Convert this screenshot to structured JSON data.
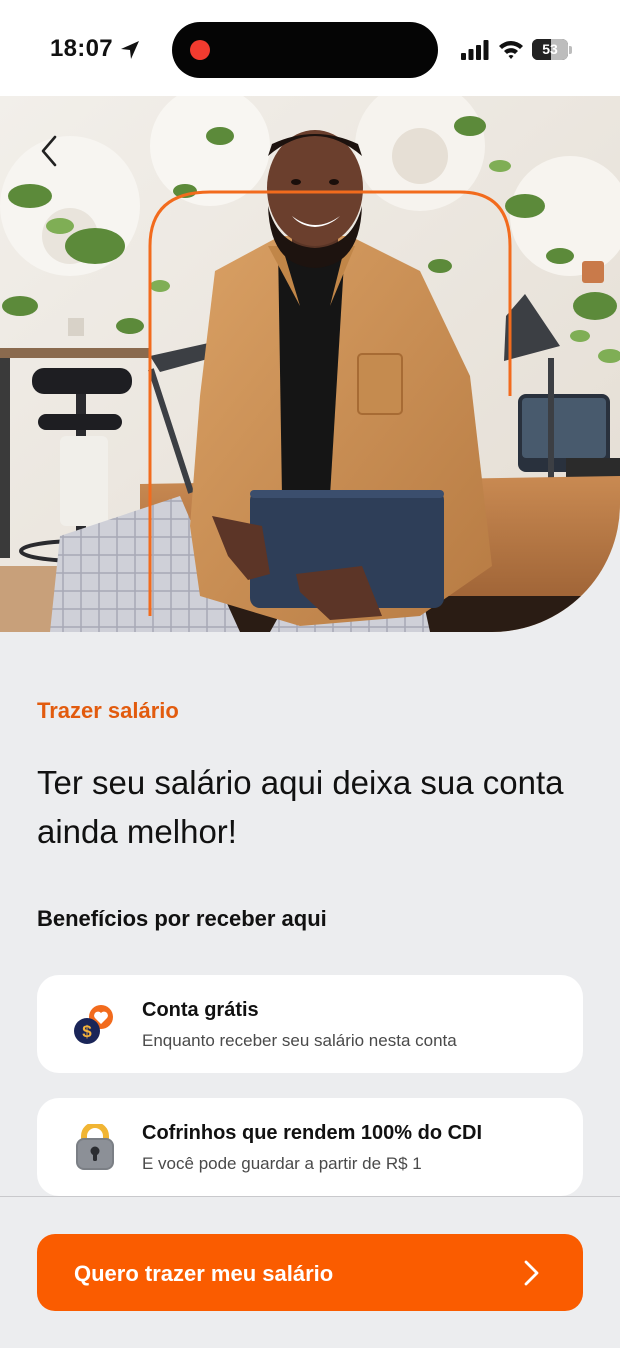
{
  "status_bar": {
    "time": "18:07",
    "battery_level": 53,
    "icons": [
      "location-arrow-icon",
      "recording-indicator",
      "cellular-signal-icon",
      "wifi-icon",
      "battery-icon"
    ]
  },
  "hero": {
    "back_icon": "chevron-left-icon",
    "photo_description": "smiling man in a tan corduroy shirt holding a laptop in an office with plants",
    "frame_color": "#f26b1d"
  },
  "content": {
    "eyebrow": "Trazer salário",
    "headline": "Ter seu salário aqui deixa sua conta ainda melhor!",
    "section_title": "Benefícios por receber aqui"
  },
  "benefits": [
    {
      "icon": "coin-heart-icon",
      "title": "Conta grátis",
      "subtitle": "Enquanto receber seu salário nesta conta"
    },
    {
      "icon": "padlock-icon",
      "title": "Cofrinhos que rendem 100% do CDI",
      "subtitle": "E você pode guardar a partir de R$ 1"
    }
  ],
  "cta": {
    "label": "Quero trazer meu salário",
    "icon": "chevron-right-icon"
  },
  "colors": {
    "accent": "#fa5c00",
    "eyebrow": "#e25b0e",
    "background": "#ecedef",
    "card": "#ffffff"
  }
}
